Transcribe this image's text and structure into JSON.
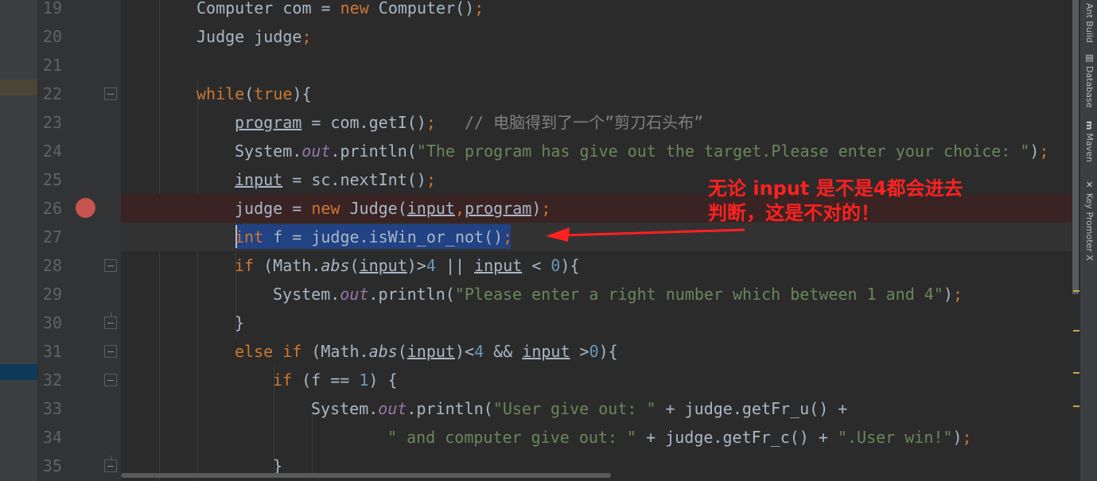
{
  "lines": [
    {
      "n": "19",
      "tokens": [
        {
          "t": "Computer com = "
        },
        {
          "t": "new ",
          "c": "kw"
        },
        {
          "t": "Computer()"
        },
        {
          "t": ";",
          "c": "kw"
        }
      ]
    },
    {
      "n": "20",
      "tokens": [
        {
          "t": "Judge judge"
        },
        {
          "t": ";",
          "c": "kw"
        }
      ]
    },
    {
      "n": "21",
      "tokens": []
    },
    {
      "n": "22",
      "tokens": [
        {
          "t": "while",
          "c": "kw"
        },
        {
          "t": "("
        },
        {
          "t": "true",
          "c": "kw"
        },
        {
          "t": "){"
        }
      ]
    },
    {
      "n": "23",
      "tokens": [
        {
          "t": "program",
          "c": "ul"
        },
        {
          "t": " = com.getI()"
        },
        {
          "t": ";",
          "c": "kw"
        },
        {
          "t": "   // 电脑得到了一个”剪刀石头布”",
          "c": "cmt"
        }
      ]
    },
    {
      "n": "24",
      "tokens": [
        {
          "t": "System."
        },
        {
          "t": "out",
          "c": "fld"
        },
        {
          "t": ".println("
        },
        {
          "t": "\"The program has give out the target.Please enter your choice: \"",
          "c": "str"
        },
        {
          "t": ")"
        },
        {
          "t": ";",
          "c": "kw"
        }
      ]
    },
    {
      "n": "25",
      "tokens": [
        {
          "t": "input",
          "c": "ul"
        },
        {
          "t": " = sc.nextInt()"
        },
        {
          "t": ";",
          "c": "kw"
        }
      ]
    },
    {
      "n": "26",
      "tokens": [
        {
          "t": "judge = "
        },
        {
          "t": "new ",
          "c": "kw"
        },
        {
          "t": "Judge("
        },
        {
          "t": "input",
          "c": "ul"
        },
        {
          "t": ",",
          "c": "kw"
        },
        {
          "t": "program",
          "c": "ul"
        },
        {
          "t": ")"
        },
        {
          "t": ";",
          "c": "kw"
        }
      ]
    },
    {
      "n": "27",
      "tokens": [
        {
          "t": "int ",
          "c": "kw"
        },
        {
          "t": "f = judge.isWin_or_not()"
        },
        {
          "t": ";",
          "c": "kw"
        }
      ]
    },
    {
      "n": "28",
      "tokens": [
        {
          "t": "if ",
          "c": "kw"
        },
        {
          "t": "(Math."
        },
        {
          "t": "abs",
          "c": "stat"
        },
        {
          "t": "("
        },
        {
          "t": "input",
          "c": "ul"
        },
        {
          "t": ")>"
        },
        {
          "t": "4",
          "c": "num"
        },
        {
          "t": " || "
        },
        {
          "t": "input",
          "c": "ul"
        },
        {
          "t": " < "
        },
        {
          "t": "0",
          "c": "num"
        },
        {
          "t": "){"
        }
      ]
    },
    {
      "n": "29",
      "tokens": [
        {
          "t": "System."
        },
        {
          "t": "out",
          "c": "fld"
        },
        {
          "t": ".println("
        },
        {
          "t": "\"Please enter a right number which between 1 and 4\"",
          "c": "str"
        },
        {
          "t": ")"
        },
        {
          "t": ";",
          "c": "kw"
        }
      ]
    },
    {
      "n": "30",
      "tokens": [
        {
          "t": "}"
        }
      ]
    },
    {
      "n": "31",
      "tokens": [
        {
          "t": "else if ",
          "c": "kw"
        },
        {
          "t": "(Math."
        },
        {
          "t": "abs",
          "c": "stat"
        },
        {
          "t": "("
        },
        {
          "t": "input",
          "c": "ul"
        },
        {
          "t": ")<"
        },
        {
          "t": "4",
          "c": "num"
        },
        {
          "t": " && "
        },
        {
          "t": "input",
          "c": "ul"
        },
        {
          "t": " >"
        },
        {
          "t": "0",
          "c": "num"
        },
        {
          "t": "){"
        }
      ]
    },
    {
      "n": "32",
      "tokens": [
        {
          "t": "if ",
          "c": "kw"
        },
        {
          "t": "(f == "
        },
        {
          "t": "1",
          "c": "num"
        },
        {
          "t": ") {"
        }
      ]
    },
    {
      "n": "33",
      "tokens": [
        {
          "t": "System."
        },
        {
          "t": "out",
          "c": "fld"
        },
        {
          "t": ".println("
        },
        {
          "t": "\"User give out: \"",
          "c": "str"
        },
        {
          "t": " + judge.getFr_u() +"
        }
      ]
    },
    {
      "n": "34",
      "tokens": [
        {
          "t": "\" and computer give out: \"",
          "c": "str"
        },
        {
          "t": " + judge.getFr_c() + "
        },
        {
          "t": "\".User win!\"",
          "c": "str"
        },
        {
          "t": ")"
        },
        {
          "t": ";",
          "c": "kw"
        }
      ]
    },
    {
      "n": "35",
      "tokens": [
        {
          "t": "}"
        }
      ]
    }
  ],
  "annotation": {
    "line1": "无论 input 是不是4都会进去",
    "line2": "判断，这是不对的！"
  },
  "tool_windows": [
    {
      "icon": "",
      "label": "Ant Build"
    },
    {
      "icon": "▤",
      "label": "Database"
    },
    {
      "icon": "m",
      "label": "Maven"
    },
    {
      "icon": "✕",
      "label": "Key Promoter X"
    }
  ],
  "colors": {
    "background": "#2b2b2b",
    "keyword": "#cc7832",
    "string": "#6a8759",
    "comment": "#808080",
    "number": "#6897bb",
    "field": "#9876aa",
    "breakpoint": "#c75450",
    "selection": "#214283",
    "annotation": "#ff2020"
  }
}
